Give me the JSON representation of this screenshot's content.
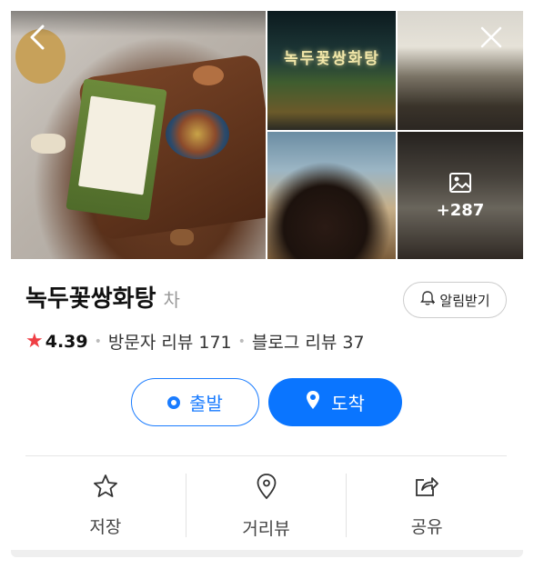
{
  "photos": {
    "more_count": "+287",
    "sign_text": "녹두꽃쌍화탕"
  },
  "place": {
    "name": "녹두꽃쌍화탕",
    "category": "차"
  },
  "alert_button": {
    "label": "알림받기"
  },
  "rating": {
    "score": "4.39",
    "visitor_reviews": "방문자 리뷰 171",
    "blog_reviews": "블로그 리뷰 37"
  },
  "route": {
    "start_label": "출발",
    "arrive_label": "도착"
  },
  "actions": {
    "save_label": "저장",
    "roadview_label": "거리뷰",
    "share_label": "공유"
  },
  "colors": {
    "accent": "#0a75ff",
    "star": "#ef3e44"
  }
}
